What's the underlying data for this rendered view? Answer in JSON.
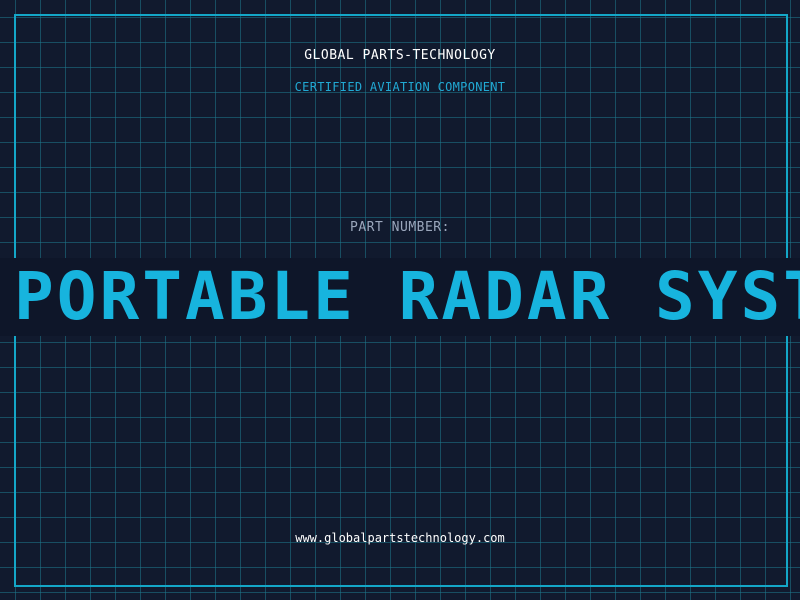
{
  "header": {
    "company": "GLOBAL PARTS-TECHNOLOGY",
    "subtitle": "CERTIFIED AVIATION COMPONENT"
  },
  "part": {
    "label": "PART NUMBER:",
    "value": "PORTABLE RADAR SYSTEM"
  },
  "footer": {
    "url": "www.globalpartstechnology.com"
  },
  "colors": {
    "background": "#111a2e",
    "grid": "#1e788c",
    "accent": "#17b4de",
    "label": "#9ba7bc",
    "text": "#ffffff"
  }
}
